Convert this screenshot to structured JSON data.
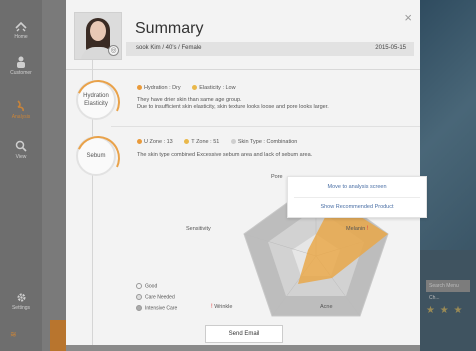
{
  "sidebar": {
    "items": [
      {
        "label": "Home"
      },
      {
        "label": "Customer"
      },
      {
        "label": "Analysis"
      },
      {
        "label": "View"
      }
    ],
    "settings_label": "Settings"
  },
  "background": {
    "search_placeholder": "Search Menu Ch...",
    "stars": "★ ★ ★"
  },
  "modal": {
    "title": "Summary",
    "close": "×",
    "user": "sook Kim / 40's / Female",
    "date": "2015-05-15",
    "sections": [
      {
        "badge": [
          "Hydration",
          "Elasticity"
        ],
        "legend": [
          {
            "label": "Hydration : Dry",
            "color": "#e99a3a"
          },
          {
            "label": "Elasticity : Low",
            "color": "#e9b84a"
          }
        ],
        "desc": [
          "They have drier skin than same age group.",
          "Due to insufficient skin elasticity, skin texture looks loose and pore looks larger."
        ]
      },
      {
        "badge": [
          "Sebum"
        ],
        "legend": [
          {
            "label": "U Zone : 13",
            "color": "#e99a3a"
          },
          {
            "label": "T Zone : 51",
            "color": "#e9b84a"
          },
          {
            "label": "Skin Type : Combination",
            "color": "#cfcfcf"
          }
        ],
        "desc": [
          "The skin type combined Excessive sebum area and lack of sebum area."
        ]
      }
    ],
    "popup": {
      "option1": "Move to analysis screen",
      "option2": "Show Recommended Product"
    },
    "radar": {
      "axes": [
        "Pore",
        "Melanin",
        "Acne",
        "Wrinkle",
        "Sensitivity"
      ],
      "warn": "!",
      "fill_color": "#e9a84a",
      "zone_color": "#bdbdbd"
    },
    "legend": [
      "Good",
      "Care Needed",
      "Intensive Care"
    ],
    "send_button": "Send Email"
  }
}
